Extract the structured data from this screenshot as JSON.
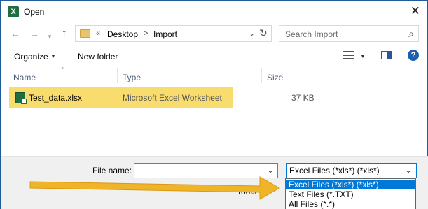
{
  "window": {
    "title": "Open",
    "app_icon_letter": "X"
  },
  "nav": {
    "back_icon": "arrow-left-icon",
    "forward_icon": "arrow-right-icon",
    "up_icon": "arrow-up-icon"
  },
  "address": {
    "overflow": "«",
    "crumbs": [
      "Desktop",
      "Import"
    ],
    "separator": ">"
  },
  "search": {
    "placeholder": "Search Import"
  },
  "toolbar": {
    "organize_label": "Organize",
    "new_folder_label": "New folder"
  },
  "columns": {
    "name": "Name",
    "type": "Type",
    "size": "Size"
  },
  "files": [
    {
      "name": "Test_data.xlsx",
      "type": "Microsoft Excel Worksheet",
      "size": "37 KB"
    }
  ],
  "footer": {
    "file_name_label": "File name:",
    "file_name_value": "",
    "filter_selected": "Excel Files (*xls*) (*xls*)",
    "tools_label": "Tools"
  },
  "filter_options": [
    "Excel Files (*xls*) (*xls*)",
    "Text Files (*.TXT)",
    "All Files (*.*)"
  ],
  "colors": {
    "highlight": "#f8dd6e",
    "selection": "#0078d7",
    "arrow": "#f0b429",
    "excel_green": "#1d6f42"
  }
}
